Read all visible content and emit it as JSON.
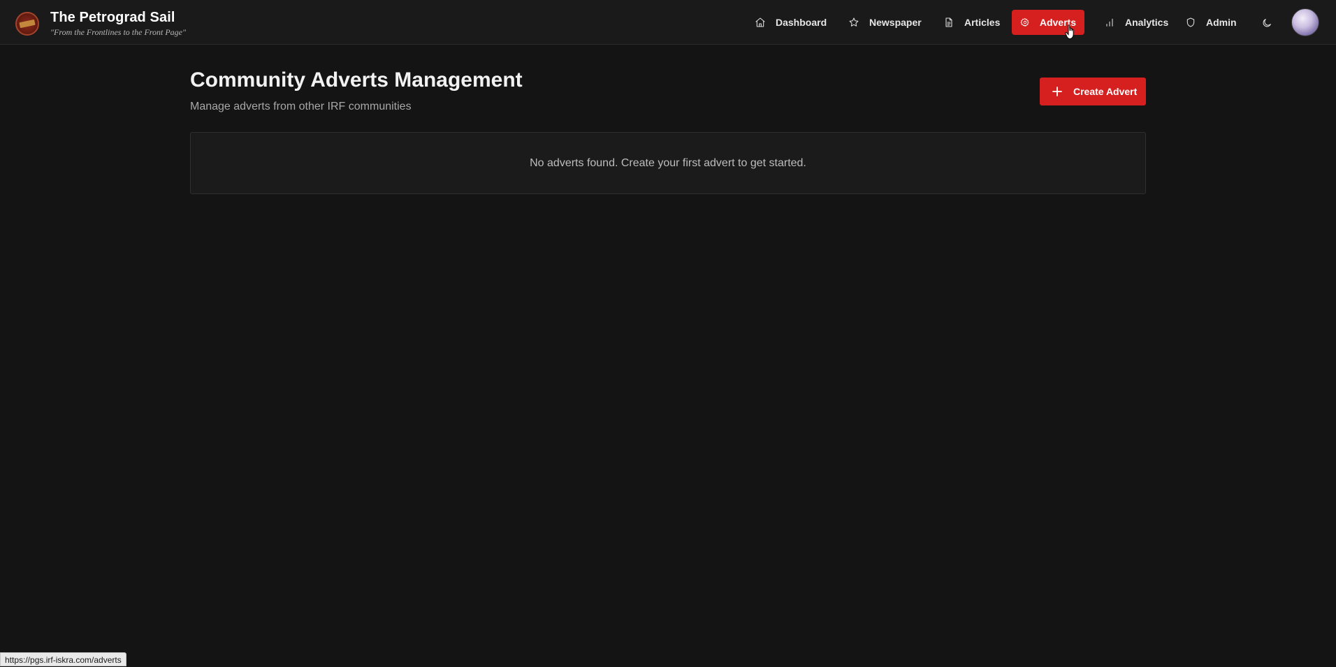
{
  "app": {
    "title": "The Petrograd Sail",
    "tagline": "\"From the Frontlines to the Front Page\"",
    "logo_icon": "newspaper-seal-logo"
  },
  "nav": {
    "items": [
      {
        "label": "Dashboard",
        "icon": "home-icon",
        "active": false
      },
      {
        "label": "Newspaper",
        "icon": "star-icon",
        "active": false
      },
      {
        "label": "Articles",
        "icon": "file-text-icon",
        "active": false
      },
      {
        "label": "Adverts",
        "icon": "gear-icon",
        "active": true
      },
      {
        "label": "Analytics",
        "icon": "bar-chart-icon",
        "active": false
      },
      {
        "label": "Admin",
        "icon": "shield-icon",
        "active": false
      }
    ],
    "theme_toggle_icon": "moon-icon",
    "avatar_icon": "user-avatar"
  },
  "main": {
    "title": "Community Adverts Management",
    "subtitle": "Manage adverts from other IRF communities",
    "create_button_label": "Create Advert",
    "empty_message": "No adverts found. Create your first advert to get started."
  },
  "status_bar": {
    "url": "https://pgs.irf-iskra.com/adverts"
  },
  "colors": {
    "accent": "#d62020",
    "background": "#141414",
    "header": "#1a1a1a",
    "panel": "#1b1b1b"
  }
}
